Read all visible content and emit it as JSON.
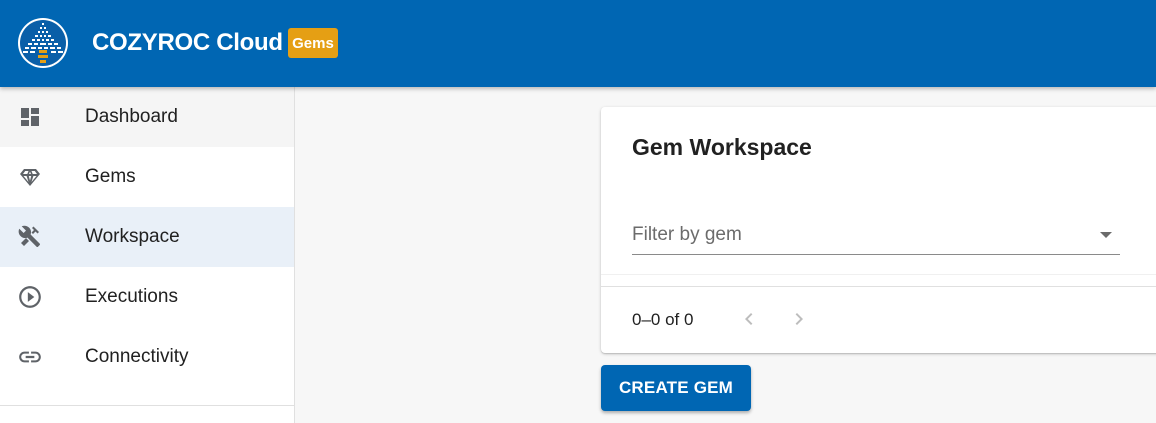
{
  "header": {
    "app_title": "COZYROC Cloud",
    "badge": "Gems",
    "brand_color": "#0066b3",
    "badge_color": "#e59f14"
  },
  "sidebar": {
    "items": [
      {
        "label": "Dashboard",
        "icon": "dashboard-icon"
      },
      {
        "label": "Gems",
        "icon": "diamond-icon"
      },
      {
        "label": "Workspace",
        "icon": "tools-icon",
        "active": true
      },
      {
        "label": "Executions",
        "icon": "play-circle-icon"
      },
      {
        "label": "Connectivity",
        "icon": "link-icon"
      }
    ]
  },
  "main": {
    "card_title": "Gem Workspace",
    "filter_placeholder": "Filter by gem",
    "pagination": "0–0 of 0",
    "create_button": "CREATE GEM"
  }
}
